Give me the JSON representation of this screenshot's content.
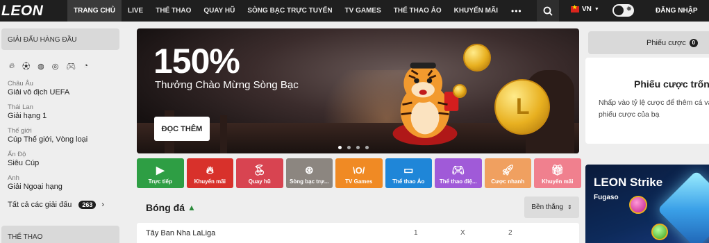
{
  "header": {
    "logo": "LEON",
    "nav": [
      {
        "label": "TRANG CHỦ",
        "active": true
      },
      {
        "label": "LIVE",
        "active": false
      },
      {
        "label": "THỂ THAO",
        "active": false
      },
      {
        "label": "QUAY HŨ",
        "active": false
      },
      {
        "label": "SÒNG BẠC TRỰC TUYẾN",
        "active": false
      },
      {
        "label": "TV GAMES",
        "active": false
      },
      {
        "label": "THỂ THAO ẢO",
        "active": false
      },
      {
        "label": "KHUYẾN MÃI",
        "active": false
      }
    ],
    "more": "•••",
    "language": "VN",
    "login_label": "ĐĂNG NHẬP"
  },
  "sidebar": {
    "top_leagues_title": "GIẢI ĐẤU HÀNG ĐẦU",
    "sport_icons": [
      "fire-icon",
      "soccer-ball-icon",
      "basketball-icon",
      "volleyball-icon",
      "gamepad-icon",
      "hockey-icon"
    ],
    "leagues": [
      {
        "country": "Châu Âu",
        "name": "Giải vô địch UEFA"
      },
      {
        "country": "Thái Lan",
        "name": "Giải hạng 1"
      },
      {
        "country": "Thế giới",
        "name": "Cúp Thế giới, Vòng loại"
      },
      {
        "country": "Ấn Độ",
        "name": "Siêu Cúp"
      },
      {
        "country": "Anh",
        "name": "Giải Ngoại hạng"
      }
    ],
    "all_leagues_label": "Tất cả các giải đấu",
    "all_leagues_count": "263",
    "sports_title": "THỂ THAO"
  },
  "banner": {
    "headline": "150%",
    "subtitle": "Thưởng Chào Mừng Sòng Bạc",
    "button_label": "ĐỌC THÊM",
    "slides": 4,
    "active_slide": 0
  },
  "tiles": [
    {
      "label": "Trực tiếp",
      "icon": "play-icon",
      "color": "#2e9e44"
    },
    {
      "label": "Khuyến mãi",
      "icon": "flame-icon",
      "color": "#d8312b"
    },
    {
      "label": "Quay hũ",
      "icon": "cherries-icon",
      "color": "#d84451"
    },
    {
      "label": "Sòng bạc trự...",
      "icon": "roulette-icon",
      "color": "#8c8680"
    },
    {
      "label": "TV Games",
      "icon": "tv-games-icon",
      "color": "#f08a24"
    },
    {
      "label": "Thể thao Ảo",
      "icon": "monitor-icon",
      "color": "#1f86d8"
    },
    {
      "label": "Thể thao điệ...",
      "icon": "gamepad-icon",
      "color": "#a05ad8"
    },
    {
      "label": "Cược nhanh",
      "icon": "rocket-icon",
      "color": "#f0a060"
    },
    {
      "label": "Khuyến mãi",
      "icon": "gift-icon",
      "color": "#f0808e"
    }
  ],
  "main": {
    "section_title": "Bóng đá",
    "sort_label": "Bền thắng",
    "league_row": {
      "name": "Tây Ban Nha LaLiga",
      "col1": "1",
      "colx": "X",
      "col2": "2"
    }
  },
  "betslip": {
    "tab_label": "Phiếu cược",
    "count": "0",
    "empty_title": "Phiếu cược trống",
    "empty_text": "Nhấp vào tỷ lệ cược để thêm cá vào phiếu cược của bạ"
  },
  "promo": {
    "title": "LEON Strike",
    "provider": "Fugaso"
  }
}
